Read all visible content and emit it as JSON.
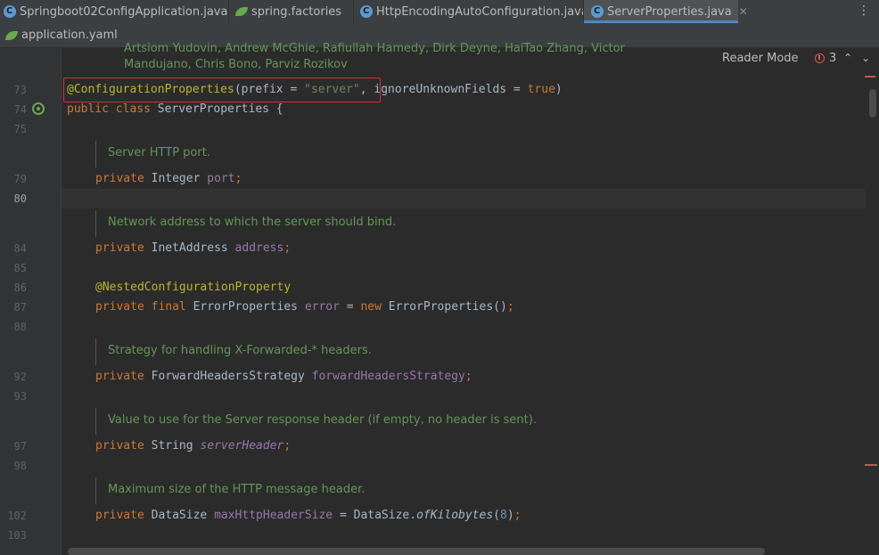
{
  "tabs": [
    {
      "label": "Springboot02ConfigApplication.java",
      "icon": "spring-class-icon"
    },
    {
      "label": "spring.factories",
      "icon": "spring-factories-icon"
    },
    {
      "label": "HttpEncodingAutoConfiguration.java",
      "icon": "class-icon"
    },
    {
      "label": "ServerProperties.java",
      "icon": "class-icon",
      "active": true
    }
  ],
  "tabs_row2": [
    {
      "label": "application.yaml",
      "icon": "yaml-icon"
    }
  ],
  "tab_close": "✕",
  "more_menu": "⋮",
  "editor": {
    "reader_mode": "Reader Mode",
    "error_count": "3",
    "nav_up": "⌃",
    "nav_down": "⌄",
    "authors_line1": "Artsiom Yudovin, Andrew McGhie, Rafiullah Hamedy, Dirk Deyne, HaiTao Zhang, Victor",
    "authors_line2": "Mandujano, Chris Bono, Parviz Rozikov",
    "line_numbers": {
      "l73": "73",
      "l74": "74",
      "l75": "75",
      "l79": "79",
      "l80": "80",
      "l84": "84",
      "l85": "85",
      "l86": "86",
      "l87": "87",
      "l88": "88",
      "l92": "92",
      "l93": "93",
      "l97": "97",
      "l98": "98",
      "l102": "102",
      "l103": "103"
    },
    "docs": {
      "port": "Server HTTP port.",
      "address": "Network address to which the server should bind.",
      "forwarded": "Strategy for handling X-Forwarded-* headers.",
      "server_header": "Value to use for the Server response header (if empty, no header is sent).",
      "max_header": "Maximum size of the HTTP message header."
    },
    "code": {
      "l73_ann": "@ConfigurationProperties",
      "l73_p1": "(prefix = ",
      "l73_str": "\"server\"",
      "l73_p2": ", ignoreUnknownFields = ",
      "l73_true": "true",
      "l73_p3": ")",
      "l74_kw": "public class ",
      "l74_rest": "ServerProperties {",
      "l79_kw": "private ",
      "l79_type": "Integer ",
      "l79_fld": "port",
      "l79_end": ";",
      "l84_kw": "private ",
      "l84_type": "InetAddress ",
      "l84_fld": "address",
      "l84_end": ";",
      "l86_ann": "@NestedConfigurationProperty",
      "l87_kw": "private final ",
      "l87_type": "ErrorProperties ",
      "l87_fld": "error",
      "l87_eq": " = ",
      "l87_new": "new ",
      "l87_rest": "ErrorProperties()",
      "l87_end": ";",
      "l92_kw": "private ",
      "l92_type": "ForwardHeadersStrategy ",
      "l92_fld": "forwardHeadersStrategy",
      "l92_end": ";",
      "l97_kw": "private ",
      "l97_type": "String ",
      "l97_fld": "serverHeader",
      "l97_end": ";",
      "l102_kw": "private ",
      "l102_type": "DataSize ",
      "l102_fld": "maxHttpHeaderSize",
      "l102_eq": " = DataSize.",
      "l102_meth": "ofKilobytes",
      "l102_p1": "(",
      "l102_num": "8",
      "l102_p2": ")",
      "l102_end": ";"
    }
  },
  "colors": {
    "keyword": "#cc7832",
    "annotation": "#bbb529",
    "string": "#6a8759",
    "field": "#9876aa",
    "doc": "#629755",
    "highlight_box": "#d03030"
  }
}
